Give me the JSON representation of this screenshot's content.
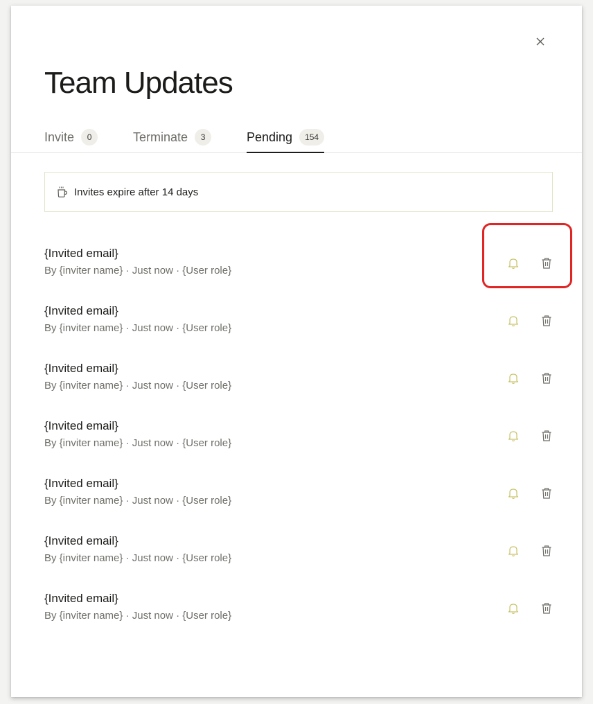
{
  "modal": {
    "title": "Team Updates",
    "close_icon": "close-icon"
  },
  "tabs": [
    {
      "label": "Invite",
      "count": "0",
      "active": false
    },
    {
      "label": "Terminate",
      "count": "3",
      "active": false
    },
    {
      "label": "Pending",
      "count": "154",
      "active": true
    }
  ],
  "notice": {
    "icon": "coffee-cup-icon",
    "text": "Invites expire after 14 days"
  },
  "rows": [
    {
      "email": "{Invited email}",
      "meta": "By {inviter name} · Just now · {User role}"
    },
    {
      "email": "{Invited email}",
      "meta": "By {inviter name} · Just now · {User role}"
    },
    {
      "email": "{Invited email}",
      "meta": "By {inviter name} · Just now · {User role}"
    },
    {
      "email": "{Invited email}",
      "meta": "By {inviter name} · Just now · {User role}"
    },
    {
      "email": "{Invited email}",
      "meta": "By {inviter name} · Just now · {User role}"
    },
    {
      "email": "{Invited email}",
      "meta": "By {inviter name} · Just now · {User role}"
    },
    {
      "email": "{Invited email}",
      "meta": "By {inviter name} · Just now · {User role}"
    }
  ],
  "row_actions": {
    "remind_icon": "bell-icon",
    "delete_icon": "trash-icon"
  },
  "colors": {
    "bell": "#c9c36a",
    "trash": "#6f6e68",
    "highlight": "#e02525",
    "notice_border": "#e3e4c8"
  }
}
